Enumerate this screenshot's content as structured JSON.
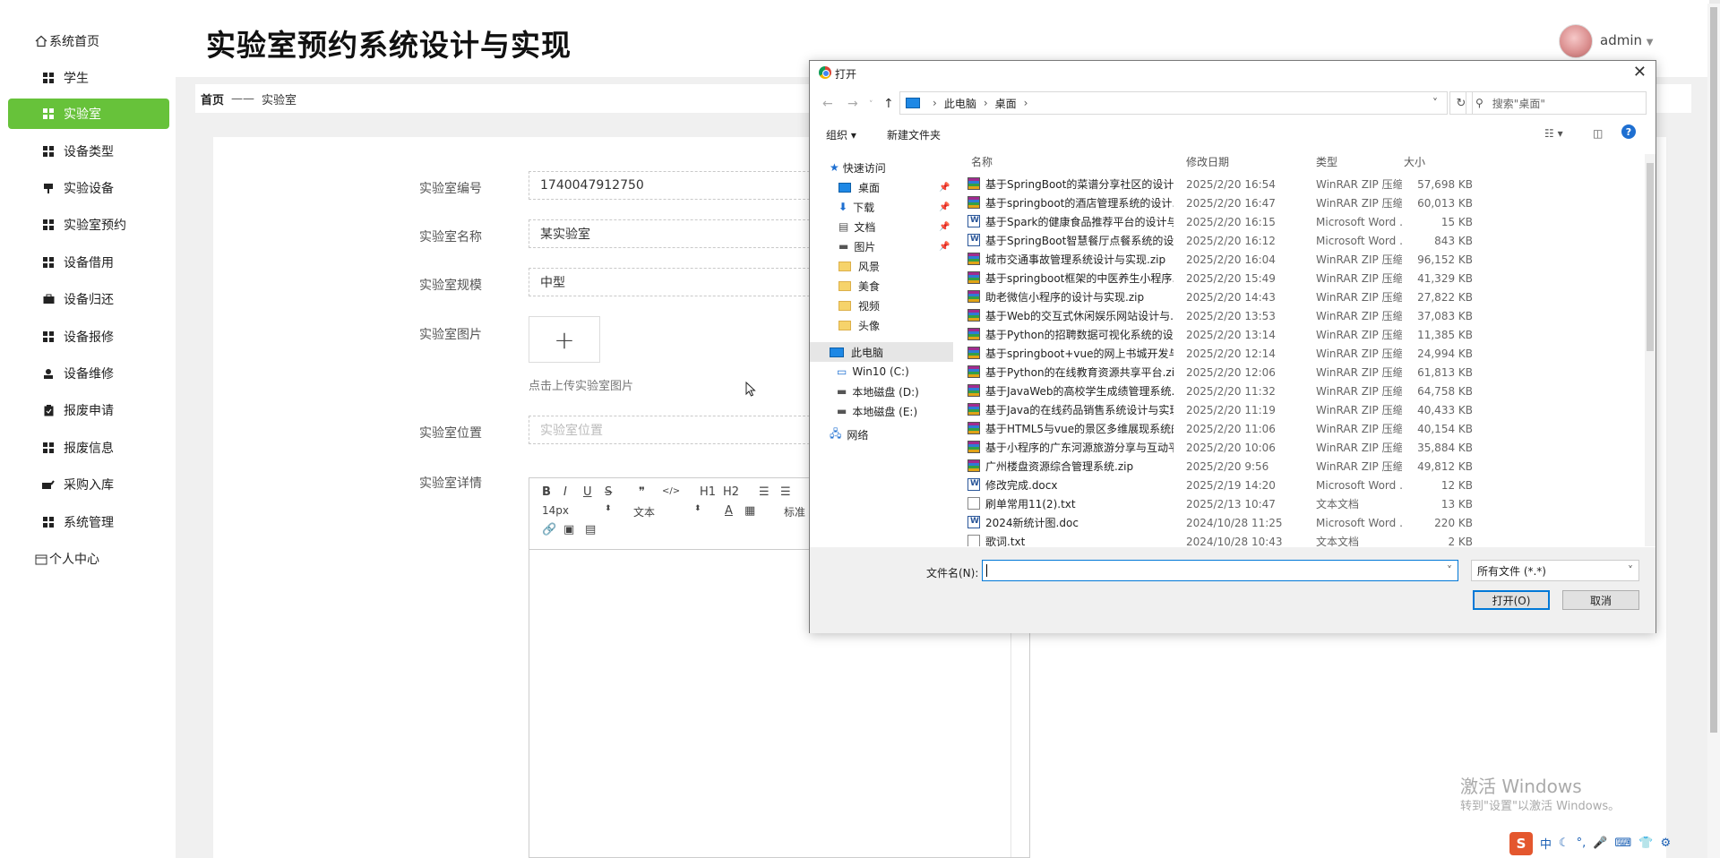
{
  "sidebar": {
    "items": [
      {
        "label": "系统首页",
        "icon": "home-icon"
      },
      {
        "label": "学生",
        "icon": "grid-icon"
      },
      {
        "label": "实验室",
        "icon": "grid-icon",
        "active": true
      },
      {
        "label": "设备类型",
        "icon": "grid-icon"
      },
      {
        "label": "实验设备",
        "icon": "device-icon"
      },
      {
        "label": "实验室预约",
        "icon": "grid-icon"
      },
      {
        "label": "设备借用",
        "icon": "grid-icon"
      },
      {
        "label": "设备归还",
        "icon": "briefcase-icon"
      },
      {
        "label": "设备报修",
        "icon": "grid-icon"
      },
      {
        "label": "设备维修",
        "icon": "user-icon"
      },
      {
        "label": "报废申请",
        "icon": "clipboard-icon"
      },
      {
        "label": "报废信息",
        "icon": "grid-icon"
      },
      {
        "label": "采购入库",
        "icon": "cart-icon"
      },
      {
        "label": "系统管理",
        "icon": "grid-icon"
      },
      {
        "label": "个人中心",
        "icon": "calendar-icon"
      }
    ],
    "active_color": "#67c23a"
  },
  "header": {
    "title": "实验室预约系统设计与实现",
    "user": "admin"
  },
  "breadcrumb": {
    "home": "首页",
    "separator": "——",
    "current": "实验室"
  },
  "form": {
    "lab_id": {
      "label": "实验室编号",
      "value": "1740047912750"
    },
    "lab_name": {
      "label": "实验室名称",
      "value": "某实验室"
    },
    "lab_scale": {
      "label": "实验室规模",
      "value": "中型"
    },
    "lab_image": {
      "label": "实验室图片",
      "plus": "+",
      "hint": "点击上传实验室图片"
    },
    "lab_location": {
      "label": "实验室位置",
      "placeholder": "实验室位置"
    },
    "lab_detail": {
      "label": "实验室详情"
    }
  },
  "editor": {
    "bold": "B",
    "italic": "I",
    "underline": "U",
    "strike": "S",
    "quote": "❞",
    "code": "</>",
    "h1": "H1",
    "h2": "H2",
    "ol": "☰",
    "ul": "☰",
    "font_size": "14px",
    "text_style": "文本",
    "color": "A",
    "bg": "▦",
    "heading": "标准"
  },
  "dialog": {
    "title": "打开",
    "close": "✕",
    "path": [
      "此电脑",
      "桌面"
    ],
    "search_placeholder": "搜索\"桌面\"",
    "organize": "组织 ▾",
    "new_folder": "新建文件夹",
    "tree": [
      {
        "label": "快速访问",
        "type": "star"
      },
      {
        "label": "桌面",
        "type": "folder-blue",
        "pinned": true
      },
      {
        "label": "下载",
        "type": "download",
        "pinned": true
      },
      {
        "label": "文档",
        "type": "doc",
        "pinned": true
      },
      {
        "label": "图片",
        "type": "pic",
        "pinned": true
      },
      {
        "label": "风景",
        "type": "folder"
      },
      {
        "label": "美食",
        "type": "folder"
      },
      {
        "label": "视频",
        "type": "folder"
      },
      {
        "label": "头像",
        "type": "folder"
      },
      {
        "label": "此电脑",
        "type": "pc",
        "selected": true
      },
      {
        "label": "Win10 (C:)",
        "type": "drive"
      },
      {
        "label": "本地磁盘 (D:)",
        "type": "drive"
      },
      {
        "label": "本地磁盘 (E:)",
        "type": "drive"
      },
      {
        "label": "网络",
        "type": "net"
      }
    ],
    "columns": {
      "name": "名称",
      "date": "修改日期",
      "type": "类型",
      "size": "大小"
    },
    "files": [
      {
        "name": "基于SpringBoot的菜谱分享社区的设计...",
        "date": "2025/2/20 16:54",
        "type": "WinRAR ZIP 压缩...",
        "size": "57,698 KB",
        "icon": "zip"
      },
      {
        "name": "基于springboot的酒店管理系统的设计...",
        "date": "2025/2/20 16:47",
        "type": "WinRAR ZIP 压缩...",
        "size": "60,013 KB",
        "icon": "zip"
      },
      {
        "name": "基于Spark的健康食品推荐平台的设计与...",
        "date": "2025/2/20 16:15",
        "type": "Microsoft Word ...",
        "size": "15 KB",
        "icon": "doc"
      },
      {
        "name": "基于SpringBoot智慧餐厅点餐系统的设...",
        "date": "2025/2/20 16:12",
        "type": "Microsoft Word ...",
        "size": "843 KB",
        "icon": "doc"
      },
      {
        "name": "城市交通事故管理系统设计与实现.zip",
        "date": "2025/2/20 16:04",
        "type": "WinRAR ZIP 压缩...",
        "size": "96,152 KB",
        "icon": "zip"
      },
      {
        "name": "基于springboot框架的中医养生小程序...",
        "date": "2025/2/20 15:49",
        "type": "WinRAR ZIP 压缩...",
        "size": "41,329 KB",
        "icon": "zip"
      },
      {
        "name": "助老微信小程序的设计与实现.zip",
        "date": "2025/2/20 14:43",
        "type": "WinRAR ZIP 压缩...",
        "size": "27,822 KB",
        "icon": "zip"
      },
      {
        "name": "基于Web的交互式休闲娱乐网站设计与...",
        "date": "2025/2/20 13:53",
        "type": "WinRAR ZIP 压缩...",
        "size": "37,083 KB",
        "icon": "zip"
      },
      {
        "name": "基于Python的招聘数据可视化系统的设...",
        "date": "2025/2/20 13:14",
        "type": "WinRAR ZIP 压缩...",
        "size": "11,385 KB",
        "icon": "zip"
      },
      {
        "name": "基于springboot+vue的网上书城开发与...",
        "date": "2025/2/20 12:14",
        "type": "WinRAR ZIP 压缩...",
        "size": "24,994 KB",
        "icon": "zip"
      },
      {
        "name": "基于Python的在线教育资源共享平台.zip",
        "date": "2025/2/20 12:06",
        "type": "WinRAR ZIP 压缩...",
        "size": "61,813 KB",
        "icon": "zip"
      },
      {
        "name": "基于JavaWeb的高校学生成绩管理系统...",
        "date": "2025/2/20 11:32",
        "type": "WinRAR ZIP 压缩...",
        "size": "64,758 KB",
        "icon": "zip"
      },
      {
        "name": "基于Java的在线药品销售系统设计与实现...",
        "date": "2025/2/20 11:19",
        "type": "WinRAR ZIP 压缩...",
        "size": "40,433 KB",
        "icon": "zip"
      },
      {
        "name": "基于HTML5与vue的景区多维展现系统的...",
        "date": "2025/2/20 11:06",
        "type": "WinRAR ZIP 压缩...",
        "size": "40,154 KB",
        "icon": "zip"
      },
      {
        "name": "基于小程序的广东河源旅游分享与互动平...",
        "date": "2025/2/20 10:06",
        "type": "WinRAR ZIP 压缩...",
        "size": "35,884 KB",
        "icon": "zip"
      },
      {
        "name": "广州楼盘资源综合管理系统.zip",
        "date": "2025/2/20 9:56",
        "type": "WinRAR ZIP 压缩...",
        "size": "49,812 KB",
        "icon": "zip"
      },
      {
        "name": "修改完成.docx",
        "date": "2025/2/19 14:20",
        "type": "Microsoft Word ...",
        "size": "12 KB",
        "icon": "doc"
      },
      {
        "name": "刷单常用11(2).txt",
        "date": "2025/2/13 10:47",
        "type": "文本文档",
        "size": "13 KB",
        "icon": "txt"
      },
      {
        "name": "2024新统计图.doc",
        "date": "2024/10/28 11:25",
        "type": "Microsoft Word ...",
        "size": "220 KB",
        "icon": "doc"
      },
      {
        "name": "歌词.txt",
        "date": "2024/10/28 10:43",
        "type": "文本文档",
        "size": "2 KB",
        "icon": "txt"
      }
    ],
    "filename_label": "文件名(N):",
    "filename_value": "",
    "filetype": "所有文件 (*.*)",
    "open_button": "打开(O)",
    "cancel_button": "取消"
  },
  "watermark": {
    "line1": "激活 Windows",
    "line2": "转到\"设置\"以激活 Windows。"
  },
  "taskbar": {
    "ime": "S",
    "lang": "中",
    "items": [
      "☾",
      "°,",
      "🎤",
      "⌨",
      "👕",
      "⚙"
    ]
  }
}
